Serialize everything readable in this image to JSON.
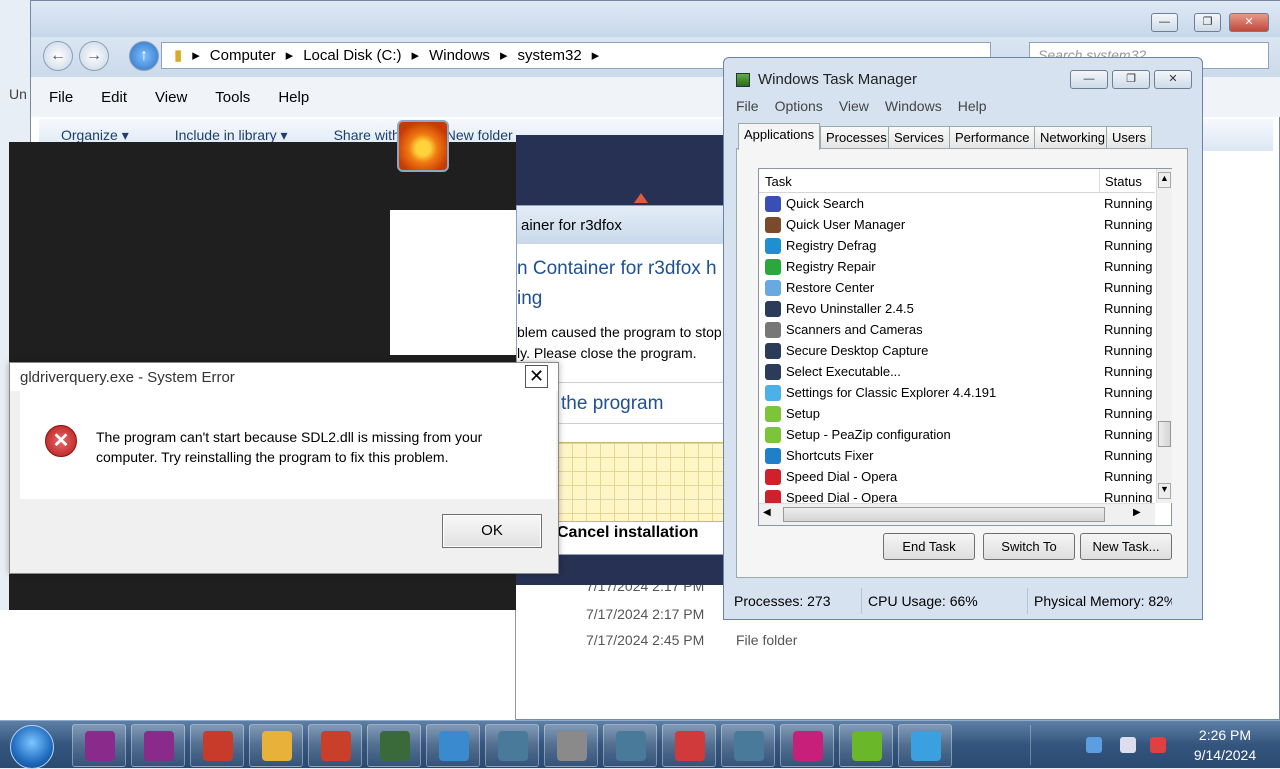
{
  "explorer": {
    "address_parts": [
      "Computer",
      "Local Disk (C:)",
      "Windows",
      "system32"
    ],
    "search_placeholder": "Search system32",
    "menu": [
      "File",
      "Edit",
      "View",
      "Tools",
      "Help"
    ],
    "commands": [
      "Organize ▾",
      "Include in library ▾",
      "Share with",
      "New folder"
    ],
    "rows": [
      {
        "date": "7/17/2024 2:17 PM",
        "type": ""
      },
      {
        "date": "7/17/2024 2:17 PM",
        "type": ""
      },
      {
        "date": "7/17/2024 2:45 PM",
        "type": "File folder"
      }
    ],
    "left_fragment": "Un"
  },
  "installer": {
    "title": "ainer for r3dfox",
    "heading_line1": "n Container for r3dfox h",
    "heading_line2": "ing",
    "message_line1": "blem caused the program to stop",
    "message_line2": "ly. Please close the program.",
    "close_link": "the program",
    "cancel": "Cancel installation"
  },
  "error_dialog": {
    "title": "gldriverquery.exe - System Error",
    "message": "The program can't start because SDL2.dll is missing from your computer. Try reinstalling the program to fix this problem.",
    "ok_label": "OK"
  },
  "task_manager": {
    "title": "Windows Task Manager",
    "menu": [
      "File",
      "Options",
      "View",
      "Windows",
      "Help"
    ],
    "tabs": [
      "Applications",
      "Processes",
      "Services",
      "Performance",
      "Networking",
      "Users"
    ],
    "columns": {
      "task": "Task",
      "status": "Status"
    },
    "tasks": [
      {
        "name": "Quick Search",
        "status": "Running",
        "color": "#3a4fb5"
      },
      {
        "name": "Quick User Manager",
        "status": "Running",
        "color": "#7a4a2a"
      },
      {
        "name": "Registry Defrag",
        "status": "Running",
        "color": "#1f8fd0"
      },
      {
        "name": "Registry Repair",
        "status": "Running",
        "color": "#2aa83c"
      },
      {
        "name": "Restore Center",
        "status": "Running",
        "color": "#6aa8e0"
      },
      {
        "name": "Revo Uninstaller 2.4.5",
        "status": "Running",
        "color": "#2b3b5a"
      },
      {
        "name": "Scanners and Cameras",
        "status": "Running",
        "color": "#777777"
      },
      {
        "name": "Secure Desktop Capture",
        "status": "Running",
        "color": "#2b3b5a"
      },
      {
        "name": "Select Executable...",
        "status": "Running",
        "color": "#2b3b5a"
      },
      {
        "name": "Settings for Classic Explorer 4.4.191",
        "status": "Running",
        "color": "#4ab2e8"
      },
      {
        "name": "Setup",
        "status": "Running",
        "color": "#7cc53a"
      },
      {
        "name": "Setup - PeaZip configuration",
        "status": "Running",
        "color": "#7cc53a"
      },
      {
        "name": "Shortcuts Fixer",
        "status": "Running",
        "color": "#1f7fc8"
      },
      {
        "name": "Speed Dial - Opera",
        "status": "Running",
        "color": "#d0202a"
      },
      {
        "name": "Speed Dial - Opera",
        "status": "Running",
        "color": "#d0202a"
      }
    ],
    "buttons": {
      "end_task": "End Task",
      "switch_to": "Switch To",
      "new_task": "New Task..."
    },
    "status": {
      "processes": "Processes: 273",
      "cpu": "CPU Usage: 66%",
      "memory": "Physical Memory: 82%"
    }
  },
  "taskbar": {
    "time": "2:26 PM",
    "date": "9/14/2024",
    "apps": [
      {
        "color": "#8a2a8a"
      },
      {
        "color": "#8a2a8a"
      },
      {
        "color": "#c83a2a"
      },
      {
        "color": "#e8b23a"
      },
      {
        "color": "#c8402a"
      },
      {
        "color": "#3a6a3a"
      },
      {
        "color": "#3a8ad0"
      },
      {
        "color": "#4a7a9a"
      },
      {
        "color": "#8a8a8a"
      },
      {
        "color": "#4a7a9a"
      },
      {
        "color": "#d03a3a"
      },
      {
        "color": "#4a7a9a"
      },
      {
        "color": "#c8207a"
      },
      {
        "color": "#6ab82a"
      },
      {
        "color": "#3aa0e0"
      }
    ]
  }
}
